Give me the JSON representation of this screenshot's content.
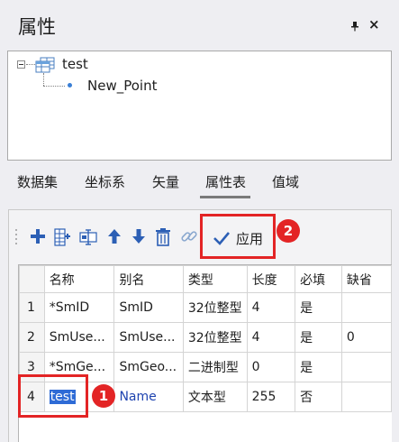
{
  "panel": {
    "title": "属性",
    "pin_icon": "pin-icon",
    "close_label": "×"
  },
  "tree": {
    "root_label": "test",
    "child_label": "New_Point",
    "root_icon": "dataset-table-icon",
    "child_icon": "point-dot-icon"
  },
  "tabs": [
    {
      "label": "数据集"
    },
    {
      "label": "坐标系"
    },
    {
      "label": "矢量"
    },
    {
      "label": "属性表",
      "active": true
    },
    {
      "label": "值域"
    }
  ],
  "toolbar": {
    "icons": [
      "add-icon",
      "insert-field-icon",
      "rename-field-icon",
      "move-up-icon",
      "move-down-icon",
      "delete-icon",
      "link-icon"
    ],
    "apply_label": "应用",
    "apply_icon": "checkmark-icon",
    "callout_apply": "2"
  },
  "table": {
    "columns": [
      "",
      "名称",
      "别名",
      "类型",
      "长度",
      "必填",
      "缺省"
    ],
    "rows": [
      {
        "num": "1",
        "name": "*SmID",
        "alias": "SmID",
        "type": "32位整型",
        "length": "4",
        "required": "是",
        "default": ""
      },
      {
        "num": "2",
        "name": "SmUse...",
        "alias": "SmUse...",
        "type": "32位整型",
        "length": "4",
        "required": "是",
        "default": "0"
      },
      {
        "num": "3",
        "name": "*SmGe...",
        "alias": "SmGeo...",
        "type": "二进制型",
        "length": "0",
        "required": "是",
        "default": ""
      },
      {
        "num": "4",
        "name": "test",
        "alias": "Name",
        "type": "文本型",
        "length": "255",
        "required": "否",
        "default": ""
      }
    ],
    "callout_edit": "1"
  },
  "colors": {
    "highlight_red": "#e32425",
    "selection_blue": "#2e6bd6",
    "link_blue": "#1f44b0",
    "toolbar_blue": "#2c5fb5"
  }
}
